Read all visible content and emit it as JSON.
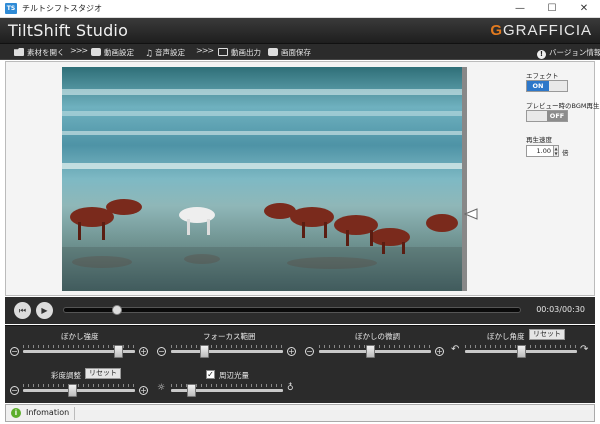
{
  "window": {
    "title": "チルトシフトスタジオ",
    "icon_text": "TS",
    "min": "—",
    "max": "☐",
    "close": "✕"
  },
  "app": {
    "title": "TiltShift Studio",
    "brand": "GRAFFICIA",
    "brand_g": "G"
  },
  "toolbar": {
    "open": "素材を開く",
    "arrow": ">>>",
    "video_settings": "動画設定",
    "audio_settings": "音声設定",
    "video_output": "動画出力",
    "save_image": "画面保存",
    "version": "バージョン情報"
  },
  "side": {
    "effect_label": "エフェクト",
    "effect_on": "ON",
    "bgm_label": "プレビュー時のBGM再生",
    "bgm_off": "OFF",
    "speed_label": "再生速度",
    "speed_value": "1.00",
    "speed_unit": "倍"
  },
  "playback": {
    "time": "00:03/00:30",
    "progress": 0.11
  },
  "controls": {
    "blur_strength": {
      "label": "ぼかし強度",
      "value": 0.88
    },
    "focus_range": {
      "label": "フォーカス範囲",
      "value": 0.28
    },
    "blur_fine": {
      "label": "ぼかしの微調",
      "value": 0.46
    },
    "blur_angle": {
      "label": "ぼかし角度",
      "value": 0.5,
      "reset": "リセット"
    },
    "saturation": {
      "label": "彩度調整",
      "value": 0.44,
      "reset": "リセット"
    },
    "vignette": {
      "label": "周辺光量",
      "checked": "✓",
      "value": 0.16
    }
  },
  "info": {
    "label": "Infomation",
    "icon": "i"
  },
  "colors": {
    "accent": "#2d77c9",
    "brand_orange": "#e27a1f",
    "info_green": "#5cae2b"
  }
}
